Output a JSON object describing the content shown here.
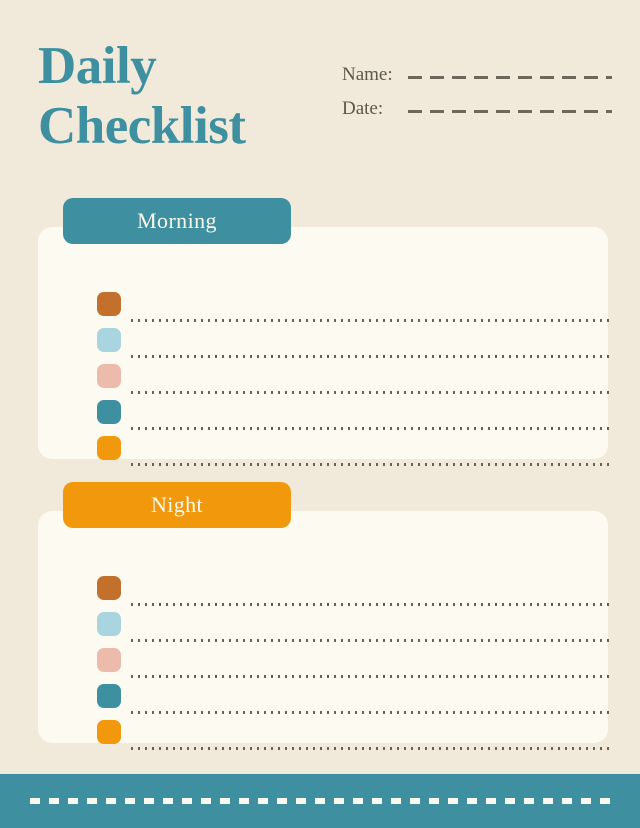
{
  "page": {
    "background_color": "#F1EADA",
    "card_color": "#FDFAF1"
  },
  "header": {
    "title_line1": "Daily",
    "title_line2": "Checklist",
    "title_color": "#3E8FA0",
    "fields": [
      {
        "label": "Name:",
        "value": ""
      },
      {
        "label": "Date:",
        "value": ""
      }
    ]
  },
  "sections": [
    {
      "id": "morning",
      "tab_label": "Morning",
      "tab_color": "#3E8FA0",
      "tab_text_color": "#FBF8F0",
      "items": [
        {
          "checkbox_color": "#C2702B",
          "text": ""
        },
        {
          "checkbox_color": "#A9D5E0",
          "text": ""
        },
        {
          "checkbox_color": "#EDBBAC",
          "text": ""
        },
        {
          "checkbox_color": "#3E8FA0",
          "text": ""
        },
        {
          "checkbox_color": "#F2980C",
          "text": ""
        }
      ]
    },
    {
      "id": "night",
      "tab_label": "Night",
      "tab_color": "#F2980C",
      "tab_text_color": "#FBF8F0",
      "items": [
        {
          "checkbox_color": "#C2702B",
          "text": ""
        },
        {
          "checkbox_color": "#A9D5E0",
          "text": ""
        },
        {
          "checkbox_color": "#EDBBAC",
          "text": ""
        },
        {
          "checkbox_color": "#3E8FA0",
          "text": ""
        },
        {
          "checkbox_color": "#F2980C",
          "text": ""
        }
      ]
    }
  ],
  "footer": {
    "background_color": "#3E8FA0",
    "dash_color": "#FBF8F0"
  }
}
